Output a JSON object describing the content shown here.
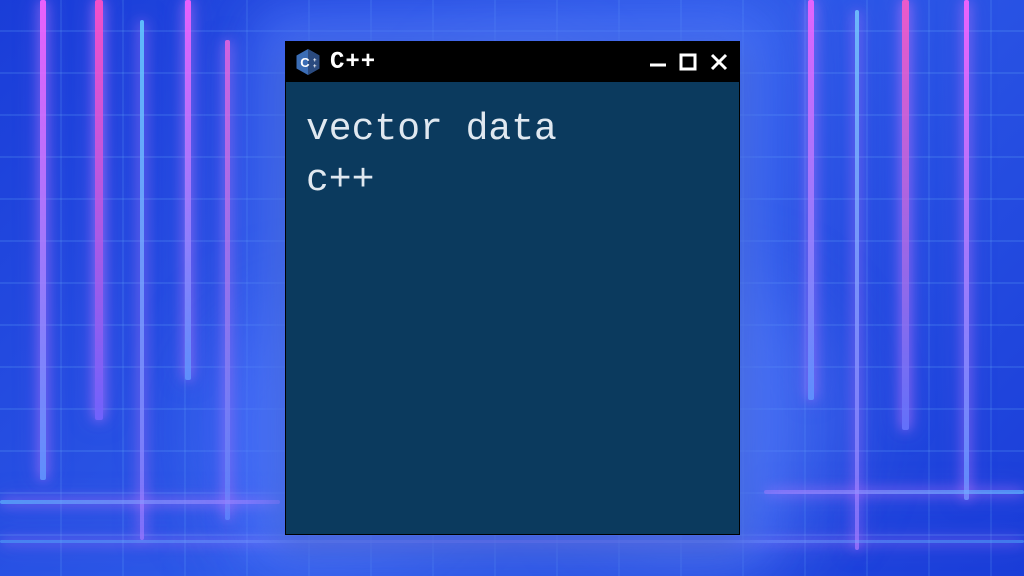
{
  "window": {
    "title": "C++",
    "content_line1": "vector data",
    "content_line2": "c++"
  },
  "colors": {
    "window_bg": "#0b3a5e",
    "titlebar_bg": "#000000",
    "text": "#e0e8f0",
    "logo_primary": "#3b6db5",
    "logo_secondary": "#2a4a7f"
  }
}
